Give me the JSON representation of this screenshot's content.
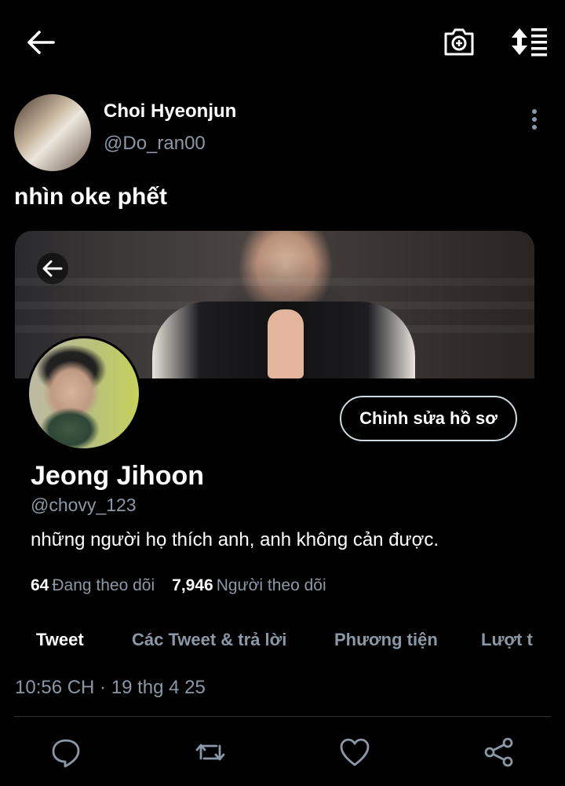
{
  "tweet": {
    "author_name": "Choi Hyeonjun",
    "author_handle": "@Do_ran00",
    "text": "nhìn oke phết",
    "timestamp": "10:56 CH · 19 thg 4 25"
  },
  "profile_card": {
    "name": "Jeong Jihoon",
    "handle": "@chovy_123",
    "bio": "những người họ thích anh, anh không cản được.",
    "edit_button_label": "Chỉnh sửa hồ sơ",
    "stats": {
      "following_count": "64",
      "following_label": "Đang theo dõi",
      "followers_count": "7,946",
      "followers_label": "Người theo dõi"
    },
    "tabs": [
      {
        "label": "Tweet"
      },
      {
        "label": "Các Tweet & trả lời"
      },
      {
        "label": "Phương tiện"
      },
      {
        "label": "Lượt t"
      }
    ]
  },
  "icons": {
    "back": "arrow-left-icon",
    "camera": "camera-plus-icon",
    "sort": "sort-icon",
    "more": "more-vertical-icon",
    "reply": "reply-icon",
    "retweet": "retweet-icon",
    "like": "heart-icon",
    "share": "share-icon"
  },
  "colors": {
    "background": "#000000",
    "text_primary": "#ffffff",
    "text_secondary": "#8b98a5",
    "divider": "#2f3336"
  }
}
